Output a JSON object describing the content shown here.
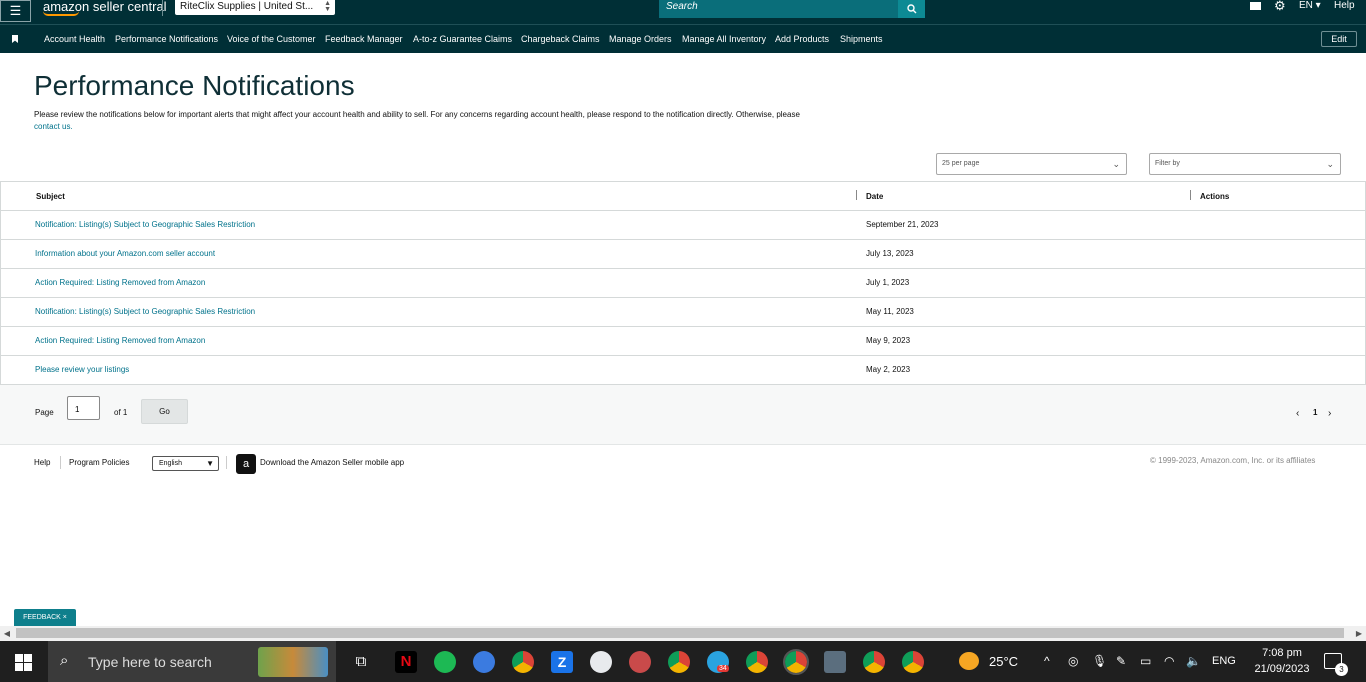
{
  "header": {
    "logo_text": "amazon seller central",
    "store_selector": "RiteClix Supplies | United St...",
    "search_placeholder": "Search",
    "language": "EN",
    "help": "Help"
  },
  "nav": {
    "items": [
      "Account Health",
      "Performance Notifications",
      "Voice of the Customer",
      "Feedback Manager",
      "A-to-z Guarantee Claims",
      "Chargeback Claims",
      "Manage Orders",
      "Manage All Inventory",
      "Add Products",
      "Shipments"
    ],
    "edit_label": "Edit"
  },
  "page": {
    "title": "Performance Notifications",
    "intro": "Please review the notifications below for important alerts that might affect your account health and ability to sell. For any concerns regarding account health, please respond to the notification directly. Otherwise, please",
    "intro_link": "contact us.",
    "per_page": "25 per page",
    "filter_placeholder": "Filter by"
  },
  "table": {
    "headers": [
      "Subject",
      "Date",
      "Actions"
    ],
    "rows": [
      {
        "subject": "Notification: Listing(s) Subject to Geographic Sales Restriction",
        "date": "September 21, 2023"
      },
      {
        "subject": "Information about your Amazon.com seller account",
        "date": "July 13, 2023"
      },
      {
        "subject": "Action Required: Listing Removed from Amazon",
        "date": "July 1, 2023"
      },
      {
        "subject": "Notification: Listing(s) Subject to Geographic Sales Restriction",
        "date": "May 11, 2023"
      },
      {
        "subject": "Action Required: Listing Removed from Amazon",
        "date": "May 9, 2023"
      },
      {
        "subject": "Please review your listings",
        "date": "May 2, 2023"
      }
    ]
  },
  "pagination": {
    "page_label": "Page",
    "page_value": "1",
    "of_label": "of 1",
    "go_label": "Go",
    "current_page": "1"
  },
  "footer": {
    "help": "Help",
    "program_policies": "Program Policies",
    "language": "English",
    "download_app": "Download the Amazon Seller mobile app",
    "copyright": "© 1999-2023, Amazon.com, Inc. or its affiliates",
    "feedback": "FEEDBACK ×"
  },
  "taskbar": {
    "search_placeholder": "Type here to search",
    "temperature": "25°C",
    "language": "ENG",
    "time": "7:08 pm",
    "date": "21/09/2023",
    "notification_count": "3",
    "telegram_badge": "34"
  },
  "colors": {
    "header_bg": "#002f36",
    "link": "#00728b",
    "accent": "#ff9900"
  }
}
